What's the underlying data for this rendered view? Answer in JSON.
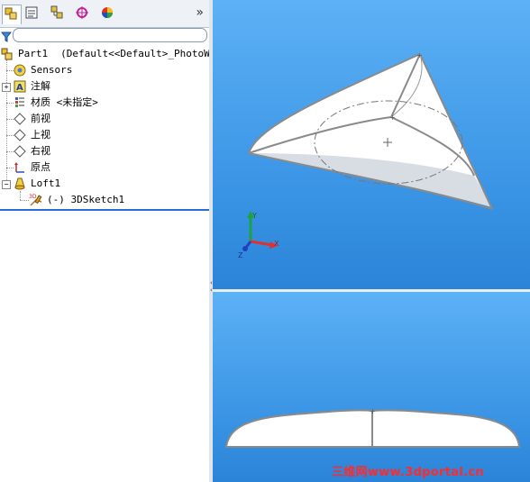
{
  "tabs": [
    {
      "name": "feature-manager",
      "icon": "feature-tree-icon",
      "active": true
    },
    {
      "name": "property-manager",
      "icon": "property-manager-icon",
      "active": false
    },
    {
      "name": "configuration-manager",
      "icon": "configuration-manager-icon",
      "active": false
    },
    {
      "name": "dimxpert-manager",
      "icon": "dimxpert-icon",
      "active": false
    },
    {
      "name": "display-manager",
      "icon": "display-manager-icon",
      "active": false
    }
  ],
  "more_symbol": "»",
  "tree": {
    "part": {
      "name": "Part1",
      "config": "(Default<<Default>_PhotoWorks"
    },
    "items": [
      {
        "label": "Sensors",
        "icon": "sensors-icon"
      },
      {
        "label": "注解",
        "icon": "annotations-icon"
      },
      {
        "label": "材质 <未指定>",
        "icon": "material-icon"
      },
      {
        "label": "前视",
        "icon": "plane-icon"
      },
      {
        "label": "上视",
        "icon": "plane-icon"
      },
      {
        "label": "右视",
        "icon": "plane-icon"
      },
      {
        "label": "原点",
        "icon": "origin-icon"
      },
      {
        "label": "Loft1",
        "icon": "loft-icon"
      },
      {
        "label": "(-) 3DSketch1",
        "icon": "3dsketch-icon"
      }
    ]
  },
  "triad": {
    "x": "X",
    "y": "Y",
    "z": "Z"
  },
  "watermark": "三维网www.3dportal.cn",
  "colors": {
    "viewport_top": "#5db1f5",
    "viewport_bottom": "#2b84d8",
    "selection_line": "#2a6bd8"
  }
}
